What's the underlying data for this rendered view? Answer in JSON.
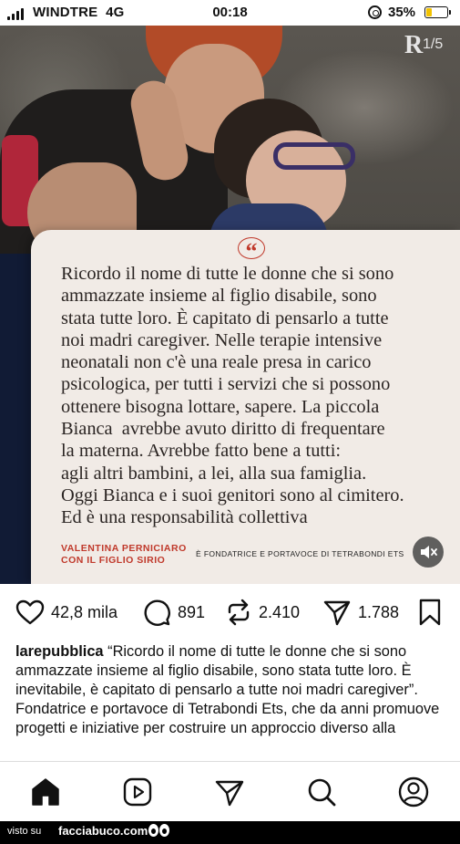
{
  "status_bar": {
    "carrier": "WINDTRE",
    "network": "4G",
    "time": "00:18",
    "battery_percent_label": "35%",
    "battery_level": 0.35,
    "battery_color": "#f2c200"
  },
  "post": {
    "media_counter": "1/5",
    "publisher_logo_text": "R",
    "quote": {
      "lines": [
        "Ricordo il nome di tutte le donne che si sono",
        "ammazzate insieme al figlio disabile, sono",
        "stata tutte loro. È capitato di pensarlo a tutte",
        "noi madri caregiver. Nelle terapie intensive",
        "neonatali non c'è una reale presa in carico",
        "psicologica, per tutti i servizi che si possono",
        "ottenere bisogna lottare, sapere. La piccola",
        "Bianca  avrebbe avuto diritto di frequentare",
        "la materna. Avrebbe fatto bene a tutti:",
        "agli altri bambini, a lei, alla sua famiglia.",
        "Oggi Bianca e i suoi genitori sono al cimitero.",
        "Ed è una responsabilità collettiva"
      ],
      "author_line1": "VALENTINA PERNICIARO",
      "author_line2": "CON IL FIGLIO SIRIO",
      "author_role": "È FONDATRICE E PORTAVOCE DI TETRABONDI ETS",
      "accent_color": "#c0392b"
    },
    "likes": "42,8 mila",
    "comments": "891",
    "reposts": "2.410",
    "shares": "1.788",
    "caption": {
      "username": "larepubblica",
      "text": "“Ricordo il nome di tutte le donne che si sono ammazzate insieme al figlio disabile, sono stata tutte loro. È inevitabile, è capitato di pensarlo a tutte noi madri caregiver”. Fondatrice e portavoce di Tetrabondi Ets, che da anni promuove progetti e iniziative per costruire un approccio diverso alla"
    }
  },
  "tab_bar": {
    "icons": [
      "home-icon",
      "reels-icon",
      "direct-icon",
      "search-icon",
      "profile-icon"
    ]
  },
  "watermark": {
    "prefix": "visto su",
    "site": "facciabuco.com"
  }
}
